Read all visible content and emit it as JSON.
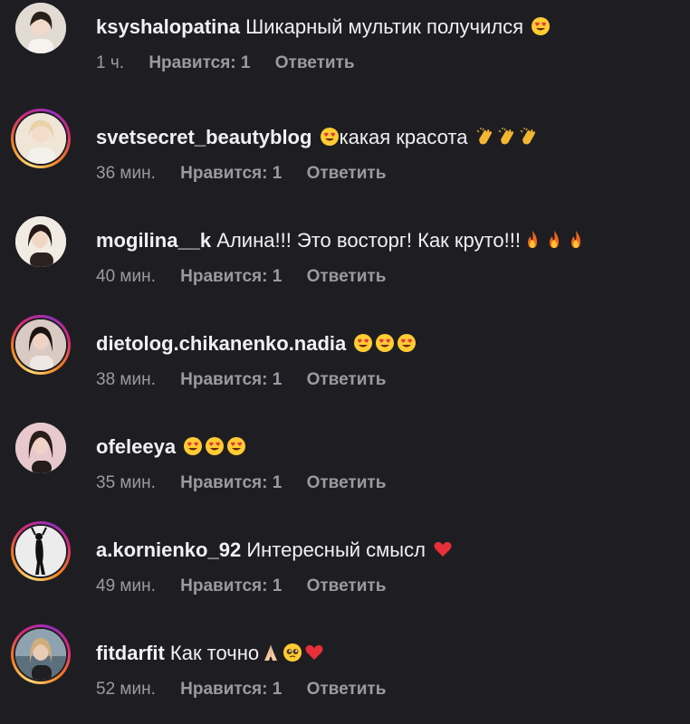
{
  "comments": [
    {
      "username": "ksyshalopatina",
      "text": "Шикарный мультик получился ",
      "emoji": [
        "heart-eyes"
      ],
      "time": "1 ч.",
      "likes": "Нравится: 1",
      "reply": "Ответить",
      "story": false,
      "avatar_bg": "#d9d2cc"
    },
    {
      "username": "svetsecret_beautyblog",
      "text": "",
      "text_after": "какая красота ",
      "emoji_before": [
        "heart-eyes"
      ],
      "emoji": [
        "clap",
        "clap",
        "clap"
      ],
      "time": "36 мин.",
      "likes": "Нравится: 1",
      "reply": "Ответить",
      "story": true,
      "avatar_bg": "#e8dccd"
    },
    {
      "username": "mogilina__k",
      "text": "Алина!!! Это восторг! Как круто!!!",
      "emoji": [
        "fire",
        "fire",
        "fire"
      ],
      "time": "40 мин.",
      "likes": "Нравится: 1",
      "reply": "Ответить",
      "story": false,
      "avatar_bg": "#ece4dc"
    },
    {
      "username": "dietolog.chikanenko.nadia",
      "text": "",
      "emoji": [
        "heart-eyes",
        "heart-eyes",
        "heart-eyes"
      ],
      "time": "38 мин.",
      "likes": "Нравится: 1",
      "reply": "Ответить",
      "story": true,
      "avatar_bg": "#d8c7c0"
    },
    {
      "username": "ofeleeya",
      "text": "",
      "emoji": [
        "heart-eyes",
        "heart-eyes",
        "heart-eyes"
      ],
      "time": "35 мин.",
      "likes": "Нравится: 1",
      "reply": "Ответить",
      "story": false,
      "avatar_bg": "#e0c4c8"
    },
    {
      "username": "a.kornienko_92",
      "text": "Интересный смысл ",
      "emoji": [
        "red-heart"
      ],
      "time": "49 мин.",
      "likes": "Нравится: 1",
      "reply": "Ответить",
      "story": true,
      "avatar_bg": "#e6e6e6"
    },
    {
      "username": "fitdarfit",
      "text": "Как точно",
      "emoji": [
        "folded-hands",
        "pleading-face",
        "red-heart"
      ],
      "time": "52 мин.",
      "likes": "Нравится: 1",
      "reply": "Ответить",
      "story": true,
      "avatar_bg": "#8fa2b0"
    }
  ],
  "colors": {
    "background": "#1e1e22",
    "text": "#f1f1f3",
    "meta": "#9a9aa0"
  }
}
